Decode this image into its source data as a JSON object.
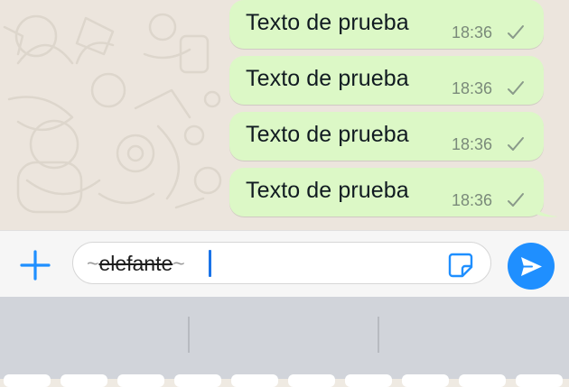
{
  "chat": {
    "messages": [
      {
        "text": "Texto de prueba",
        "time": "18:36",
        "status_icon": "single-check-icon"
      },
      {
        "text": "Texto de prueba",
        "time": "18:36",
        "status_icon": "single-check-icon"
      },
      {
        "text": "Texto de prueba",
        "time": "18:36",
        "status_icon": "single-check-icon"
      },
      {
        "text": "Texto de prueba",
        "time": "18:36",
        "status_icon": "single-check-icon"
      }
    ],
    "bubble_color": "#dcf8c6",
    "wallpaper_color": "#ece5dd"
  },
  "composer": {
    "attach_icon": "plus-icon",
    "message_value": {
      "prefix": "~",
      "word": "elefante",
      "suffix": "~"
    },
    "sticker_icon": "sticker-icon",
    "send_icon": "send-icon",
    "accent_color": "#1f8fff"
  },
  "keyboard": {
    "background_color": "#d1d4da",
    "suggestions": [
      "",
      "",
      ""
    ]
  }
}
